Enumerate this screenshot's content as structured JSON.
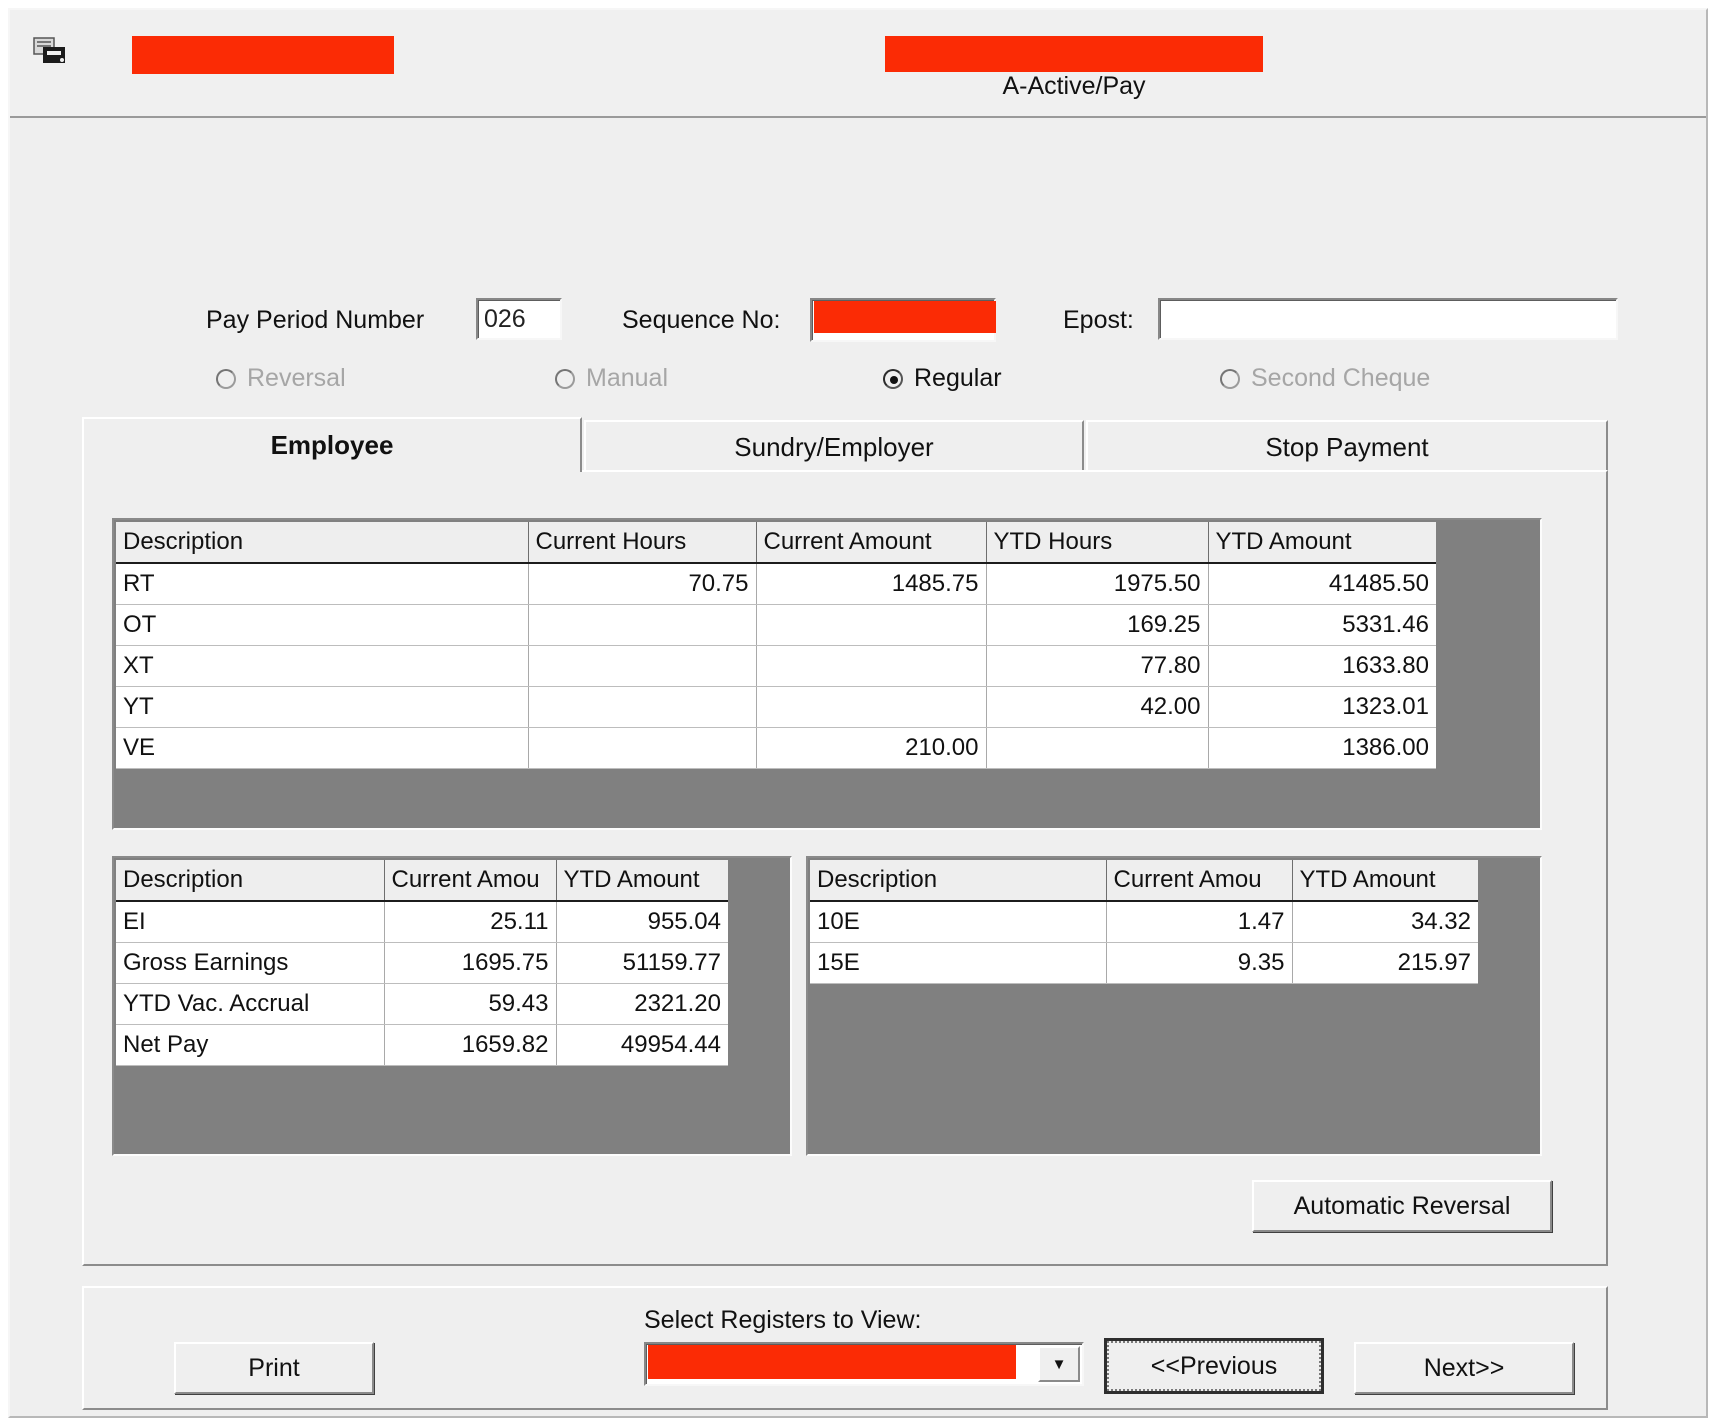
{
  "window": {
    "icon": "printer-documents-icon",
    "title_redacted": true,
    "subtitle_redacted": true,
    "status_text": "A-Active/Pay"
  },
  "form": {
    "pay_period_label": "Pay Period Number",
    "pay_period_value": "026",
    "sequence_label": "Sequence No:",
    "sequence_value_redacted": true,
    "epost_label": "Epost:",
    "epost_value": "",
    "epost_placeholder": ""
  },
  "pay_type_radios": [
    {
      "label": "Reversal",
      "selected": false,
      "disabled": true
    },
    {
      "label": "Manual",
      "selected": false,
      "disabled": true
    },
    {
      "label": "Regular",
      "selected": true,
      "disabled": false
    },
    {
      "label": "Second Cheque",
      "selected": false,
      "disabled": true
    }
  ],
  "tabs": [
    {
      "label": "Employee",
      "active": true
    },
    {
      "label": "Sundry/Employer",
      "active": false
    },
    {
      "label": "Stop Payment",
      "active": false
    }
  ],
  "earnings_grid": {
    "columns": [
      "Description",
      "Current Hours",
      "Current Amount",
      "YTD Hours",
      "YTD Amount"
    ],
    "rows": [
      {
        "description": "RT",
        "current_hours": "70.75",
        "current_amount": "1485.75",
        "ytd_hours": "1975.50",
        "ytd_amount": "41485.50"
      },
      {
        "description": "OT",
        "current_hours": "",
        "current_amount": "",
        "ytd_hours": "169.25",
        "ytd_amount": "5331.46"
      },
      {
        "description": "XT",
        "current_hours": "",
        "current_amount": "",
        "ytd_hours": "77.80",
        "ytd_amount": "1633.80"
      },
      {
        "description": "YT",
        "current_hours": "",
        "current_amount": "",
        "ytd_hours": "42.00",
        "ytd_amount": "1323.01"
      },
      {
        "description": "VE",
        "current_hours": "",
        "current_amount": "210.00",
        "ytd_hours": "",
        "ytd_amount": "1386.00"
      }
    ]
  },
  "deductions_grid": {
    "columns": [
      "Description",
      "Current Amou",
      "YTD Amount"
    ],
    "rows": [
      {
        "description": "EI",
        "current_amount": "25.11",
        "ytd_amount": "955.04"
      },
      {
        "description": "Gross Earnings",
        "current_amount": "1695.75",
        "ytd_amount": "51159.77"
      },
      {
        "description": "YTD Vac. Accrual",
        "current_amount": "59.43",
        "ytd_amount": "2321.20"
      },
      {
        "description": "Net Pay",
        "current_amount": "1659.82",
        "ytd_amount": "49954.44"
      }
    ]
  },
  "taxes_grid": {
    "columns": [
      "Description",
      "Current Amou",
      "YTD Amount"
    ],
    "rows": [
      {
        "description": "10E",
        "current_amount": "1.47",
        "ytd_amount": "34.32"
      },
      {
        "description": "15E",
        "current_amount": "9.35",
        "ytd_amount": "215.97"
      }
    ]
  },
  "buttons": {
    "automatic_reversal": "Automatic Reversal",
    "print": "Print",
    "previous": "<<Previous",
    "next": "Next>>"
  },
  "register_selector": {
    "label": "Select Registers to View:",
    "value_redacted": true,
    "arrow_icon": "chevron-down-icon"
  }
}
